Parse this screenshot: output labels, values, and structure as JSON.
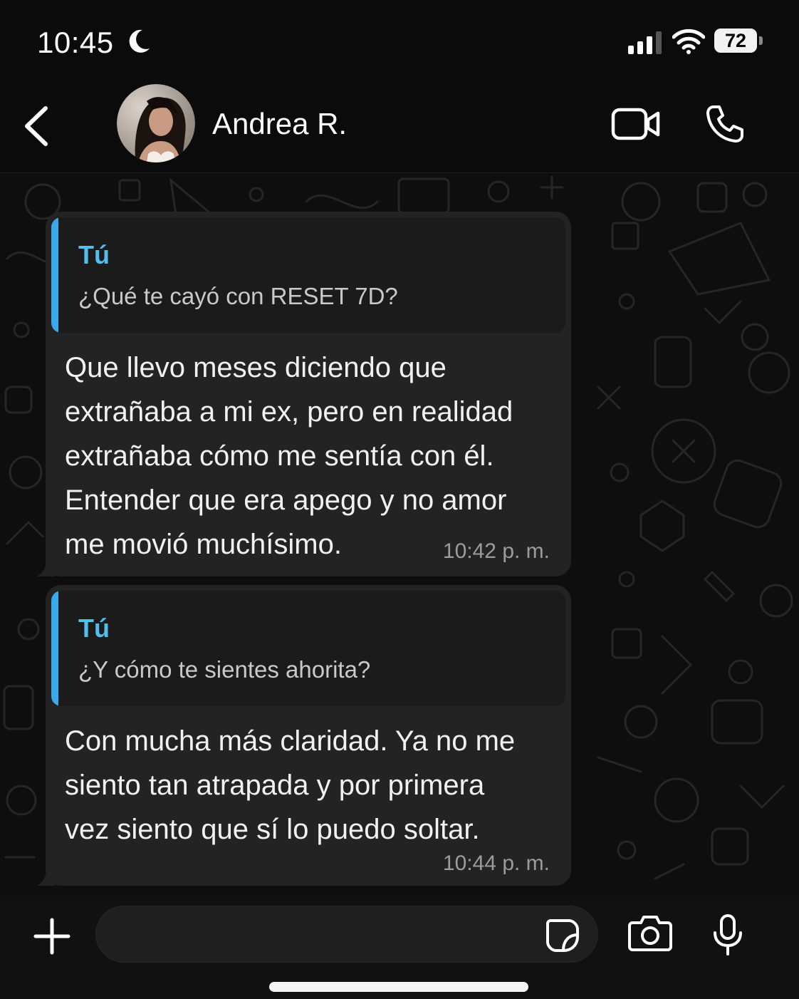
{
  "status_bar": {
    "time": "10:45",
    "battery": "72",
    "icons": [
      "moon-icon",
      "signal-icon",
      "wifi-icon",
      "battery-icon"
    ]
  },
  "header": {
    "contact_name": "Andrea R.",
    "icons": [
      "back-chevron-icon",
      "video-camera-icon",
      "phone-icon"
    ]
  },
  "messages": [
    {
      "quote_author": "Tú",
      "quote_text": "¿Qué te cayó con RESET 7D?",
      "lines": [
        "Que llevo meses diciendo que",
        "extrañaba a mi ex, pero en realidad",
        "extrañaba cómo me sentía con él.",
        "Entender que era apego y no amor",
        "me movió muchísimo."
      ],
      "time": "10:42 p. m."
    },
    {
      "quote_author": "Tú",
      "quote_text": "¿Y cómo te sientes ahorita?",
      "lines": [
        "Con mucha más claridad. Ya no me",
        "siento tan atrapada y por primera",
        "vez siento que sí lo puedo soltar."
      ],
      "time": "10:44 p. m."
    }
  ],
  "input_bar": {
    "icons": [
      "plus-icon",
      "sticker-icon",
      "camera-icon",
      "microphone-icon"
    ]
  },
  "colors": {
    "background": "#0b0b0b",
    "bubble": "#232323",
    "quote_bg": "#1b1b1b",
    "quote_accent": "#3aa9ea",
    "quote_author": "#53bdeb",
    "timestamp": "#9c9c9c"
  }
}
